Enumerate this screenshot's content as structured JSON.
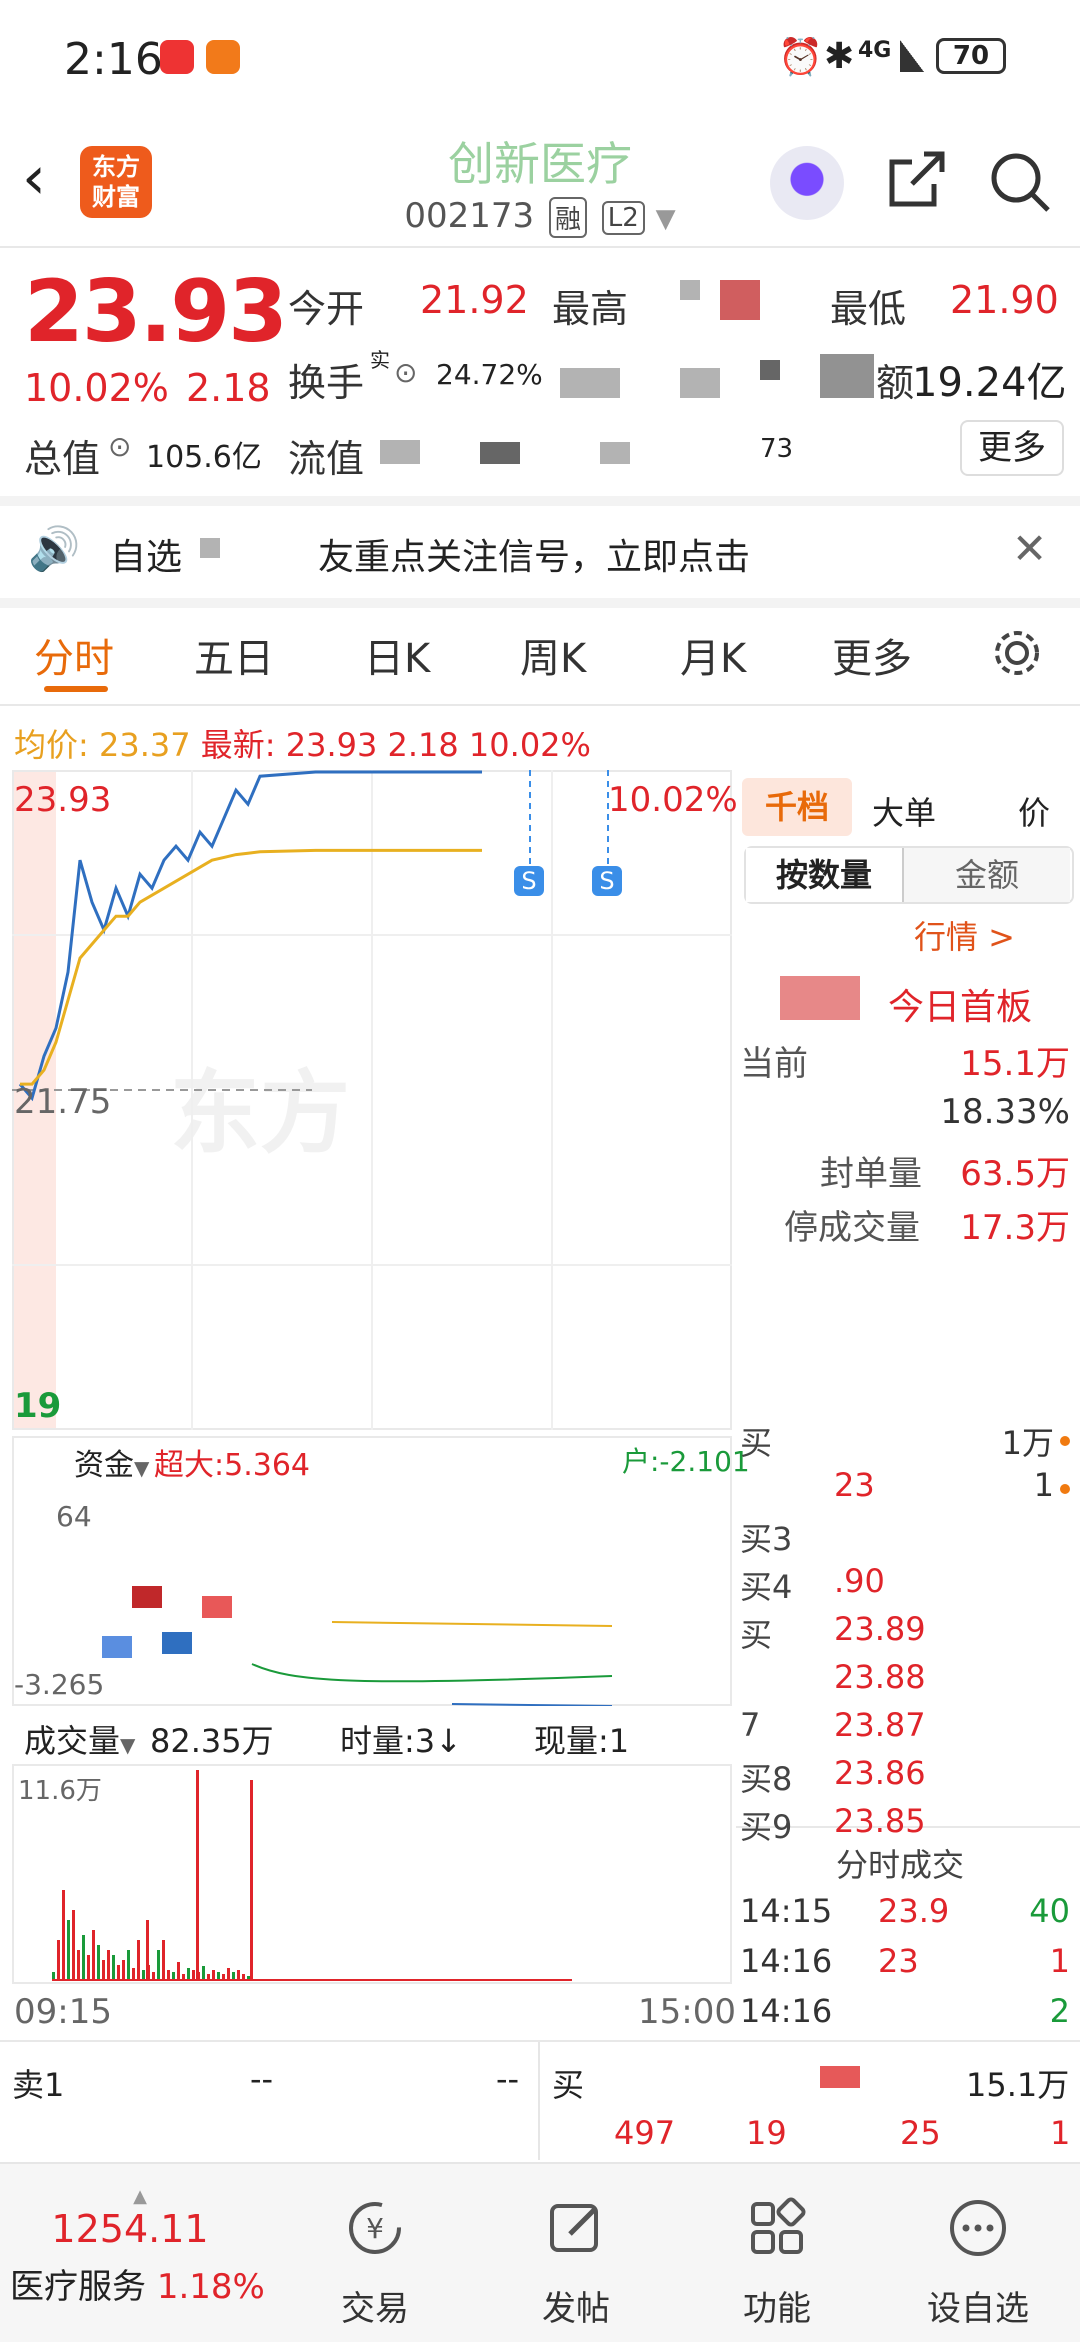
{
  "status_bar": {
    "time": "2:16",
    "battery": "70",
    "network": "4G"
  },
  "header": {
    "stock_name": "创新医疗",
    "stock_code": "002173",
    "tag_margin": "融",
    "tag_level": "L2",
    "logo_line1": "东方",
    "logo_line2": "财富"
  },
  "quote": {
    "price": "23.93",
    "change_pct": "10.02%",
    "change_amt": "2.18",
    "open_label": "今开",
    "open_value": "21.92",
    "high_label": "最高",
    "low_label": "最低",
    "low_value": "21.90",
    "turnover_label": "换手",
    "turnover_sup": "实",
    "turnover_value": "24.72%",
    "amount_label": "额",
    "amount_value": "19.24亿",
    "mktcap_label": "总值",
    "mktcap_value": "105.6亿",
    "float_label": "流值",
    "float_partial": "73",
    "more_button": "更多"
  },
  "notice": {
    "text_a": "自选",
    "text_b": "友重点关注信号，立即点击"
  },
  "tabs": [
    "分时",
    "五日",
    "日K",
    "周K",
    "月K",
    "更多"
  ],
  "info_line": {
    "avg_label": "均价:",
    "avg_value": "23.37",
    "latest_label": "最新:",
    "latest_value": "23.93",
    "chg": "2.18",
    "pct": "10.02%"
  },
  "chart": {
    "top_price": "23.93",
    "mid_price": "21.75",
    "bottom_price": "19",
    "top_pct": "10.02%",
    "signal_label": "S",
    "watermark": "东方"
  },
  "chart_data": {
    "type": "line",
    "series": [
      {
        "name": "price",
        "values": [
          21.7,
          21.6,
          21.9,
          22.1,
          22.5,
          23.3,
          23.0,
          22.8,
          23.1,
          22.9,
          23.2,
          23.1,
          23.3,
          23.4,
          23.3,
          23.5,
          23.4,
          23.6,
          23.8,
          23.7,
          23.9,
          23.93,
          23.93,
          23.93,
          23.93
        ]
      },
      {
        "name": "avg",
        "values": [
          21.7,
          21.7,
          21.8,
          22.0,
          22.3,
          22.6,
          22.7,
          22.8,
          22.9,
          22.9,
          23.0,
          23.05,
          23.1,
          23.15,
          23.2,
          23.25,
          23.3,
          23.32,
          23.34,
          23.35,
          23.36,
          23.37,
          23.37,
          23.37,
          23.37
        ]
      }
    ],
    "x_start": "09:15",
    "x_end": "15:00",
    "ylim": [
      19.5,
      23.93
    ]
  },
  "side_panel": {
    "tab_qiandang": "千档",
    "tab_dadan": "大单",
    "tab_fenjia": "价",
    "seg_qty": "按数量",
    "seg_amt": "金额",
    "link_hq": "行情 >",
    "first_board": "今日首板",
    "rows": [
      {
        "k": "当前",
        "v": "15.1万"
      },
      {
        "k": "",
        "v": "18.33%"
      },
      {
        "k": "封单量",
        "v": "63.5万"
      },
      {
        "k": "停成交量",
        "v": "17.3万"
      }
    ]
  },
  "order_book": [
    {
      "k": "买",
      "p": "",
      "q": "1万"
    },
    {
      "k": "",
      "p": "23",
      "q": "1"
    },
    {
      "k": "买3",
      "p": "",
      "q": ""
    },
    {
      "k": "买4",
      "p": ".90",
      "q": ""
    },
    {
      "k": "买",
      "p": "23.89",
      "q": ""
    },
    {
      "k": "",
      "p": "23.88",
      "q": ""
    },
    {
      "k": "7",
      "p": "23.87",
      "q": ""
    },
    {
      "k": "买8",
      "p": "23.86",
      "q": ""
    },
    {
      "k": "买9",
      "p": "23.85",
      "q": ""
    }
  ],
  "trades_title": "分时成交",
  "trades": [
    {
      "t": "14:15",
      "p": "23.9",
      "q": "40",
      "color": "#1a9a3a"
    },
    {
      "t": "14:16",
      "p": "23",
      "q": "1",
      "color": "#e0242a"
    },
    {
      "t": "14:16",
      "p": "",
      "q": "2",
      "color": "#1a9a3a"
    }
  ],
  "indicator": {
    "select": "资金",
    "super_big": "超大:5.364",
    "retail": "户:-2.101",
    "top_val": "64",
    "bottom_val": "-3.265"
  },
  "volume": {
    "select": "成交量",
    "total": "82.35万",
    "time_vol": "时量:3↓",
    "now_vol": "现量:1",
    "max_label": "11.6万",
    "t_start": "09:15",
    "t_end": "15:00"
  },
  "bottom_quotes": {
    "sell1": "卖1",
    "sell1_p": "--",
    "sell1_q": "--",
    "buy1": "买",
    "buy1_q": "15.1万",
    "r2_a": "497",
    "r2_b": "19",
    "r2_c": "25",
    "r2_d": "1"
  },
  "nav": {
    "index_value": "1254.11",
    "index_name": "医疗服务",
    "index_pct": "1.18%",
    "items": [
      "交易",
      "发帖",
      "功能",
      "设自选"
    ]
  }
}
